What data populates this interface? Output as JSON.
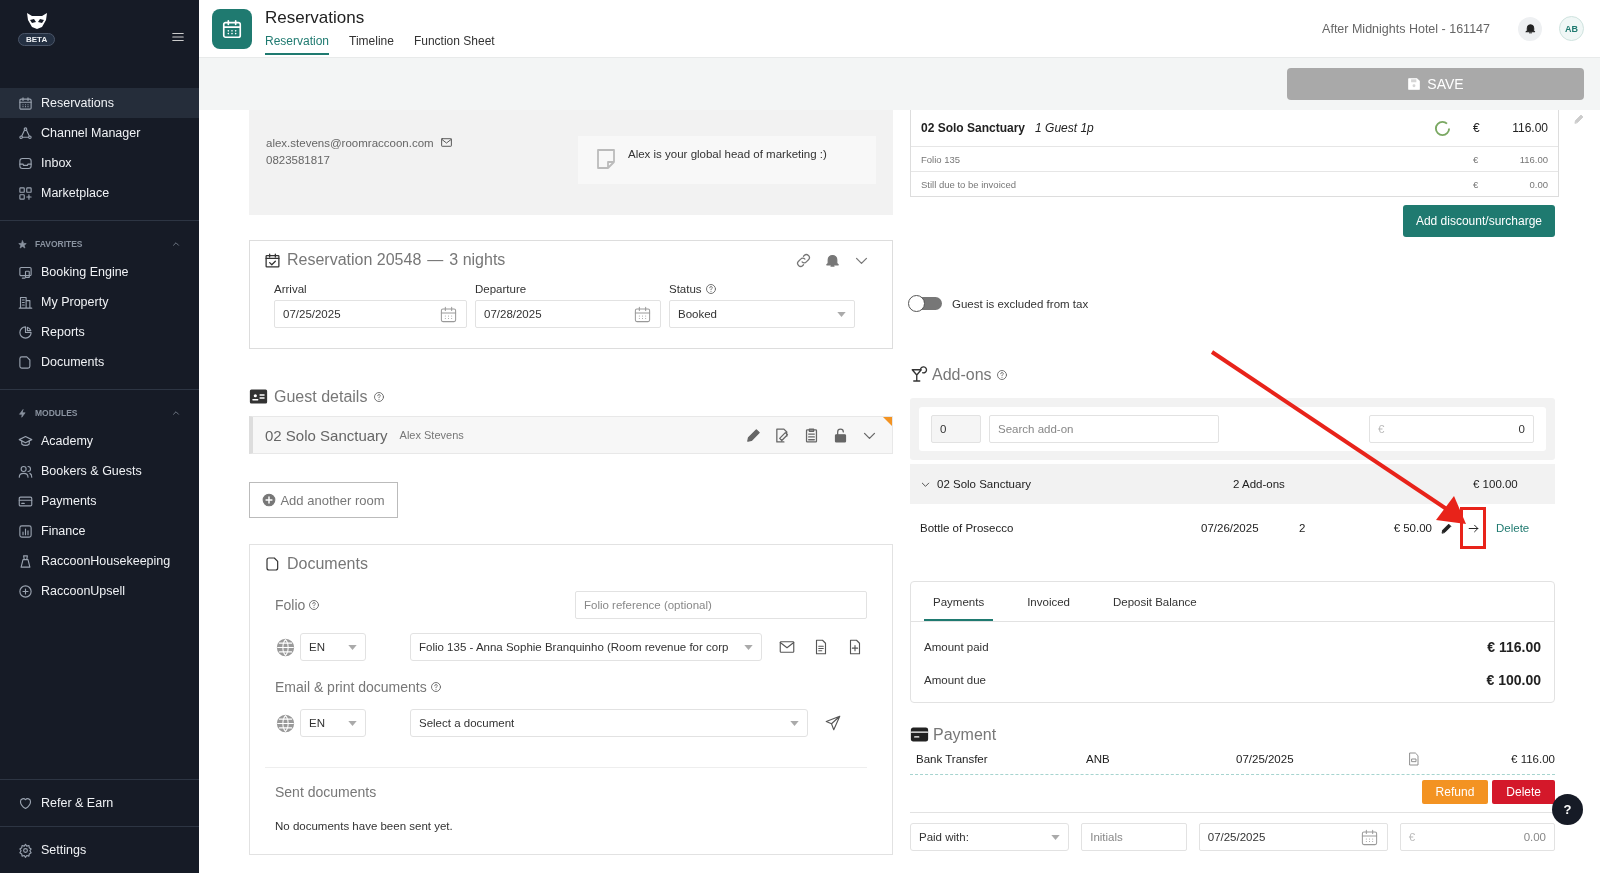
{
  "sidebar": {
    "beta_badge": "BETA",
    "main_items": [
      {
        "label": "Reservations",
        "selected": true
      },
      {
        "label": "Channel Manager",
        "selected": false
      },
      {
        "label": "Inbox",
        "selected": false
      },
      {
        "label": "Marketplace",
        "selected": false
      }
    ],
    "favorites": {
      "title": "FAVORITES",
      "expanded": true,
      "items": [
        {
          "label": "Booking Engine",
          "selected": false
        },
        {
          "label": "My Property",
          "selected": false
        },
        {
          "label": "Reports",
          "selected": false
        },
        {
          "label": "Documents",
          "selected": false
        }
      ]
    },
    "modules": {
      "title": "MODULES",
      "expanded": true,
      "items": [
        {
          "label": "Academy",
          "selected": false
        },
        {
          "label": "Bookers & Guests",
          "selected": false
        },
        {
          "label": "Payments",
          "selected": false
        },
        {
          "label": "Finance",
          "selected": false
        },
        {
          "label": "RaccoonHousekeeping",
          "selected": false
        },
        {
          "label": "RaccoonUpsell",
          "selected": false
        }
      ]
    },
    "bottom_items": [
      {
        "label": "Refer & Earn",
        "selected": false
      },
      {
        "label": "Settings",
        "selected": false
      }
    ]
  },
  "header": {
    "title": "Reservations",
    "tabs": [
      {
        "label": "Reservation",
        "selected": true
      },
      {
        "label": "Timeline",
        "selected": false
      },
      {
        "label": "Function Sheet",
        "selected": false
      }
    ],
    "hotel": "After Midnights Hotel - 161147",
    "avatar": "AB"
  },
  "save_button": {
    "label": "SAVE",
    "disabled": true
  },
  "guest_card": {
    "email": "alex.stevens@roomraccoon.com",
    "phone": "0823581817",
    "note": "Alex is your global head of marketing :)"
  },
  "reservation": {
    "title": "Reservation 20548",
    "separator": "—",
    "nights": "3 nights",
    "fields": [
      {
        "label": "Arrival",
        "value": "07/25/2025",
        "kind": "date",
        "help": false
      },
      {
        "label": "Departure",
        "value": "07/28/2025",
        "kind": "date",
        "help": false
      },
      {
        "label": "Status",
        "value": "Booked",
        "kind": "select",
        "help": true
      }
    ]
  },
  "guest_details": {
    "title": "Guest details",
    "room": "02 Solo Sanctuary",
    "guest": "Alex Stevens",
    "add_room": "Add another room"
  },
  "documents": {
    "title": "Documents",
    "folio_label": "Folio",
    "folio_reference_placeholder": "Folio reference (optional)",
    "folio_language": "EN",
    "folio": "Folio 135 - Anna Sophie Branquinho (Room revenue for corp",
    "email_label": "Email & print documents",
    "email_language": "EN",
    "document_placeholder": "Select a document",
    "sent_title": "Sent documents",
    "sent_empty": "No documents have been sent yet."
  },
  "room_summary": {
    "room": "02 Solo Sanctuary",
    "guests": "1 Guest 1p",
    "currency": "€",
    "amount": "116.00",
    "lines": [
      {
        "label": "Folio 135",
        "currency": "€",
        "amount": "116.00"
      },
      {
        "label": "Still due to be invoiced",
        "currency": "€",
        "amount": "0.00"
      }
    ],
    "button": "Add discount/surcharge"
  },
  "tax_toggle": {
    "label": "Guest is excluded from tax",
    "on": false
  },
  "addons": {
    "title": "Add-ons",
    "quantity": "0",
    "search_placeholder": "Search add-on",
    "price_currency": "€",
    "price": "0",
    "group": {
      "room": "02 Solo Sanctuary",
      "count": "2 Add-ons",
      "total": "€ 100.00",
      "expanded": true
    },
    "items": [
      {
        "name": "Bottle of Prosecco",
        "date": "07/26/2025",
        "quantity": "2",
        "price": "€ 50.00",
        "action": "Delete",
        "highlighted": true
      }
    ]
  },
  "balance": {
    "tabs": [
      {
        "label": "Payments",
        "selected": true
      },
      {
        "label": "Invoiced",
        "selected": false
      },
      {
        "label": "Deposit Balance",
        "selected": false
      }
    ],
    "rows": [
      {
        "label": "Amount paid",
        "value": "€ 116.00"
      },
      {
        "label": "Amount due",
        "value": "€ 100.00"
      }
    ]
  },
  "payment": {
    "title": "Payment",
    "entries": [
      {
        "method": "Bank Transfer",
        "initials": "ANB",
        "date": "07/25/2025",
        "amount": "€ 116.00"
      }
    ],
    "refund": "Refund",
    "delete": "Delete",
    "new": {
      "method_placeholder": "Paid with:",
      "initials_placeholder": "Initials",
      "date": "07/25/2025",
      "currency": "€",
      "amount_placeholder": "0.00"
    }
  },
  "help_button": "?"
}
